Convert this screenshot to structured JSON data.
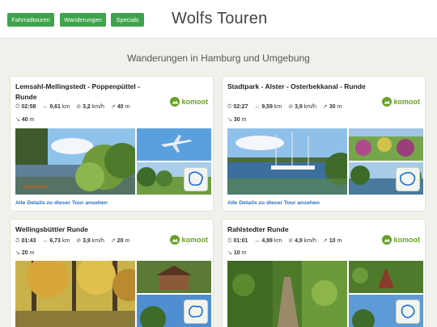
{
  "nav": {
    "buttons": [
      "Fahrradtouren",
      "Wanderungen",
      "Specials"
    ],
    "brand": "Wolfs Touren"
  },
  "page": {
    "subtitle": "Wanderungen in Hamburg und Umgebung",
    "details_link": "Alle Details zu dieser Tour ansehen",
    "provider": "komoot"
  },
  "tours": [
    {
      "title": "Lemsahl-Mellingstedt - Poppenpüttel - Runde",
      "duration": "02:58",
      "distance": "9,61",
      "distance_unit": "km",
      "speed": "3,2",
      "speed_unit": "km/h",
      "ascent": "40",
      "ascent_unit": "m",
      "descent": "40",
      "descent_unit": "m"
    },
    {
      "title": "Stadtpark - Alster - Osterbekkanal - Runde",
      "duration": "02:27",
      "distance": "9,59",
      "distance_unit": "km",
      "speed": "3,9",
      "speed_unit": "km/h",
      "ascent": "30",
      "ascent_unit": "m",
      "descent": "30",
      "descent_unit": "m"
    },
    {
      "title": "Wellingsbüttler Runde",
      "duration": "01:43",
      "distance": "6,73",
      "distance_unit": "km",
      "speed": "3,9",
      "speed_unit": "km/h",
      "ascent": "20",
      "ascent_unit": "m",
      "descent": "20",
      "descent_unit": "m"
    },
    {
      "title": "Rahlstedter Runde",
      "duration": "01:01",
      "distance": "4,99",
      "distance_unit": "km",
      "speed": "4,9",
      "speed_unit": "km/h",
      "ascent": "10",
      "ascent_unit": "m",
      "descent": "10",
      "descent_unit": "m"
    }
  ],
  "icons": {
    "time": "clock-icon",
    "distance": "distance-arrows-icon",
    "speed": "speed-icon",
    "ascent": "up-arrow-icon",
    "descent": "down-arrow-icon",
    "logo": "komoot-logo-icon"
  },
  "colors": {
    "accent": "#3fa34d",
    "komoot": "#6aa127",
    "link": "#2a6fbf"
  }
}
